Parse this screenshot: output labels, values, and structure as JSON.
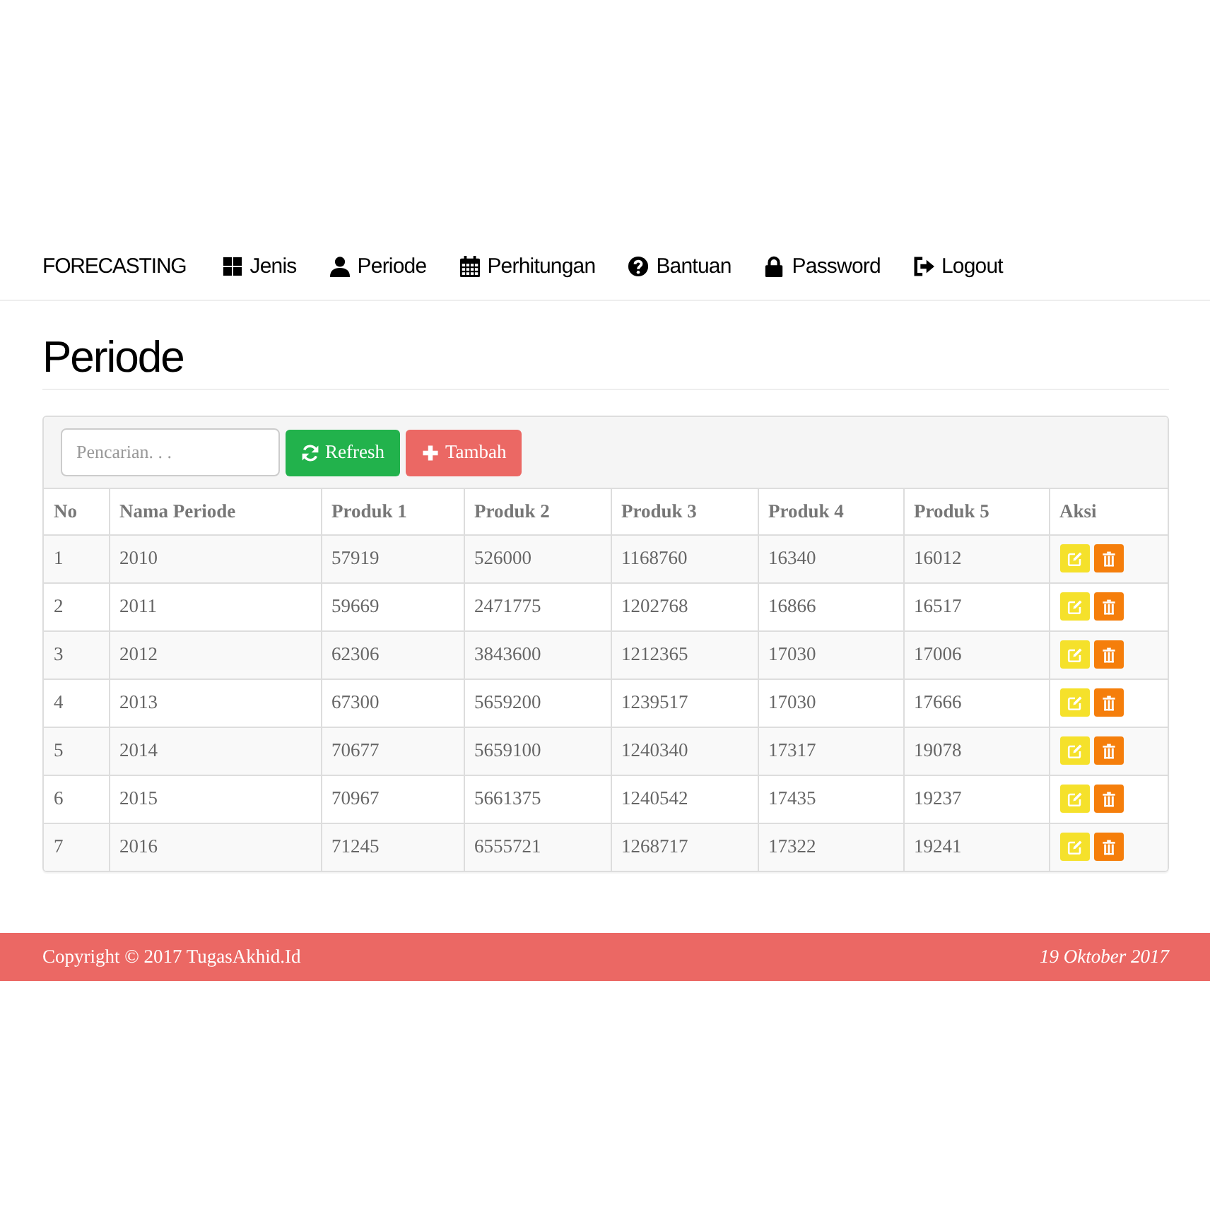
{
  "navbar": {
    "brand": "FORECASTING",
    "items": [
      {
        "label": "Jenis",
        "kind": "grid"
      },
      {
        "label": "Periode",
        "kind": "user"
      },
      {
        "label": "Perhitungan",
        "kind": "calendar"
      },
      {
        "label": "Bantuan",
        "kind": "help"
      },
      {
        "label": "Password",
        "kind": "lock"
      },
      {
        "label": "Logout",
        "kind": "logout"
      }
    ]
  },
  "page_title": "Periode",
  "toolbar": {
    "search": {
      "placeholder": "Pencarian. . ."
    },
    "buttons": [
      {
        "label": "Refresh",
        "kind": "refresh"
      },
      {
        "label": "Tambah",
        "kind": "add"
      }
    ]
  },
  "table": {
    "columns": [
      "No",
      "Nama Periode",
      "Produk 1",
      "Produk 2",
      "Produk 3",
      "Produk 4",
      "Produk 5",
      "Aksi"
    ],
    "rows": [
      {
        "cells": [
          "1",
          "2010",
          "57919",
          "526000",
          "1168760",
          "16340",
          "16012"
        ]
      },
      {
        "cells": [
          "2",
          "2011",
          "59669",
          "2471775",
          "1202768",
          "16866",
          "16517"
        ]
      },
      {
        "cells": [
          "3",
          "2012",
          "62306",
          "3843600",
          "1212365",
          "17030",
          "17006"
        ]
      },
      {
        "cells": [
          "4",
          "2013",
          "67300",
          "5659200",
          "1239517",
          "17030",
          "17666"
        ]
      },
      {
        "cells": [
          "5",
          "2014",
          "70677",
          "5659100",
          "1240340",
          "17317",
          "19078"
        ]
      },
      {
        "cells": [
          "6",
          "2015",
          "70967",
          "5661375",
          "1240542",
          "17435",
          "19237"
        ]
      },
      {
        "cells": [
          "7",
          "2016",
          "71245",
          "6555721",
          "1268717",
          "17322",
          "19241"
        ]
      }
    ]
  },
  "footer": {
    "copyright": "Copyright © 2017 TugasAkhid.Id",
    "date": "19 Oktober 2017"
  }
}
